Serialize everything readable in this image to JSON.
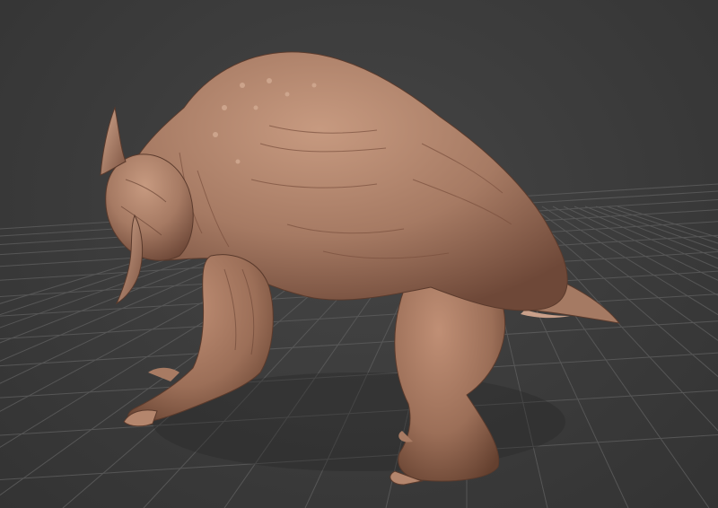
{
  "viewport": {
    "background_color": "#3a3a3a",
    "grid_color": "#5a5a5a",
    "model_color": "#a67a63",
    "model_highlight_color": "#c79a80",
    "model_shadow_color": "#6e4838",
    "model": "sculpted-creature",
    "grid": true
  }
}
